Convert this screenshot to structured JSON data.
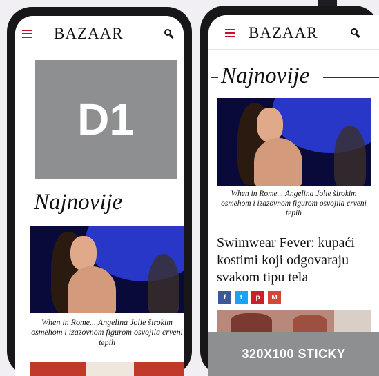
{
  "brand": {
    "logo_text": "BAZAAR",
    "accent_color": "#c8102e",
    "placeholder_gray": "#8e8f91"
  },
  "phone_left": {
    "ad_label": "D1",
    "section_title": "Najnovije",
    "article_caption": "When in Rome... Angelina Jolie širokim osmehom i izazovnom figurom osvojila crveni tepih"
  },
  "phone_right": {
    "section_title": "Najnovije",
    "article_caption": "When in Rome... Angelina Jolie širokim osmehom i izazovnom figurom osvojila crveni tepih",
    "headline": "Swimwear Fever: kupaći kostimi koji odgovaraju svakom tipu tela",
    "share_buttons": [
      {
        "icon": "facebook-icon",
        "glyph": "f",
        "color": "#3b5998"
      },
      {
        "icon": "twitter-icon",
        "glyph": "t",
        "color": "#1da1f2"
      },
      {
        "icon": "pinterest-icon",
        "glyph": "p",
        "color": "#cb2027"
      },
      {
        "icon": "gmail-icon",
        "glyph": "M",
        "color": "#d44638"
      }
    ],
    "sticky_ad_label": "320X100 STICKY"
  }
}
